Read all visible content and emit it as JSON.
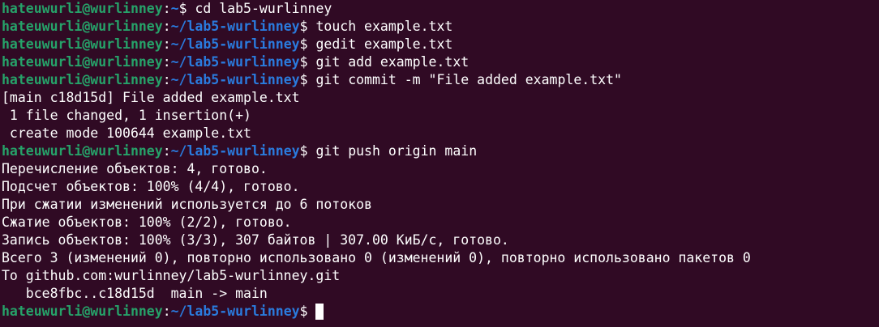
{
  "terminal": {
    "background": "#300a24",
    "user_color": "#26a269",
    "path_color": "#2a7bde",
    "lines": [
      {
        "type": "prompt",
        "user": "hateuwurli@wurlinney",
        "path": "~",
        "command": "cd lab5-wurlinney"
      },
      {
        "type": "prompt",
        "user": "hateuwurli@wurlinney",
        "path": "~/lab5-wurlinney",
        "command": "touch example.txt"
      },
      {
        "type": "prompt",
        "user": "hateuwurli@wurlinney",
        "path": "~/lab5-wurlinney",
        "command": "gedit example.txt"
      },
      {
        "type": "prompt",
        "user": "hateuwurli@wurlinney",
        "path": "~/lab5-wurlinney",
        "command": "git add example.txt"
      },
      {
        "type": "prompt",
        "user": "hateuwurli@wurlinney",
        "path": "~/lab5-wurlinney",
        "command": "git commit -m \"File added example.txt\""
      },
      {
        "type": "output",
        "text": "[main c18d15d] File added example.txt"
      },
      {
        "type": "output",
        "text": " 1 file changed, 1 insertion(+)"
      },
      {
        "type": "output",
        "text": " create mode 100644 example.txt"
      },
      {
        "type": "prompt",
        "user": "hateuwurli@wurlinney",
        "path": "~/lab5-wurlinney",
        "command": "git push origin main"
      },
      {
        "type": "output",
        "text": "Перечисление объектов: 4, готово."
      },
      {
        "type": "output",
        "text": "Подсчет объектов: 100% (4/4), готово."
      },
      {
        "type": "output",
        "text": "При сжатии изменений используется до 6 потоков"
      },
      {
        "type": "output",
        "text": "Сжатие объектов: 100% (2/2), готово."
      },
      {
        "type": "output",
        "text": "Запись объектов: 100% (3/3), 307 байтов | 307.00 КиБ/с, готово."
      },
      {
        "type": "output",
        "text": "Всего 3 (изменений 0), повторно использовано 0 (изменений 0), повторно использовано пакетов 0"
      },
      {
        "type": "output",
        "text": "To github.com:wurlinney/lab5-wurlinney.git"
      },
      {
        "type": "output",
        "text": "   bce8fbc..c18d15d  main -> main"
      },
      {
        "type": "prompt",
        "user": "hateuwurli@wurlinney",
        "path": "~/lab5-wurlinney",
        "command": "",
        "cursor": true
      }
    ]
  }
}
